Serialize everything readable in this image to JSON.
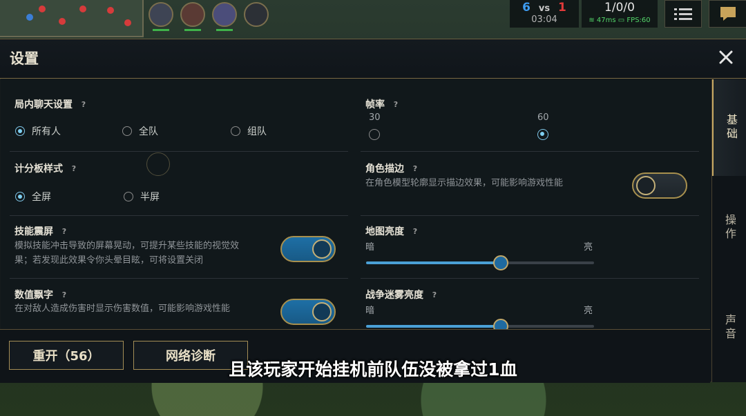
{
  "hud": {
    "score_blue": "6",
    "score_vs": "vs",
    "score_red": "1",
    "timer": "03:04",
    "kda": "1/0/0",
    "ping": "47ms",
    "fps": "FPS:60"
  },
  "panel": {
    "title": "设置",
    "tabs": [
      {
        "label": "基础",
        "active": true
      },
      {
        "label": "操作",
        "active": false
      },
      {
        "label": "声音",
        "active": false
      }
    ]
  },
  "settings": {
    "chat": {
      "title": "局内聊天设置",
      "help": "?",
      "options": [
        "所有人",
        "全队",
        "组队"
      ],
      "selected": "所有人"
    },
    "framerate": {
      "title": "帧率",
      "help": "?",
      "options": [
        "30",
        "60"
      ],
      "selected": "60"
    },
    "scoreboard": {
      "title": "计分板样式",
      "help": "?",
      "options": [
        "全屏",
        "半屏"
      ],
      "selected": "全屏"
    },
    "outline": {
      "title": "角色描边",
      "help": "?",
      "desc": "在角色模型轮廓显示描边效果，可能影响游戏性能",
      "enabled": false
    },
    "shake": {
      "title": "技能震屏",
      "help": "?",
      "desc_line1": "模拟技能冲击导致的屏幕晃动，可提升某些技能的视觉效",
      "desc_line2": "果；若发现此效果令你头晕目眩，可将设置关闭",
      "enabled": true
    },
    "map_brightness": {
      "title": "地图亮度",
      "help": "?",
      "min_label": "暗",
      "max_label": "亮",
      "level": 0.59
    },
    "damage_numbers": {
      "title": "数值飘字",
      "help": "?",
      "desc": "在对敌人造成伤害时显示伤害数值，可能影响游戏性能",
      "enabled": true
    },
    "fog_brightness": {
      "title": "战争迷雾亮度",
      "help": "?",
      "min_label": "暗",
      "max_label": "亮",
      "level": 0.59
    }
  },
  "buttons": {
    "restart": "重开（56）",
    "network": "网络诊断"
  },
  "subtitle": "且该玩家开始挂机前队伍没被拿过1血",
  "colors": {
    "accent_gold": "#a8904e",
    "toggle_on": "#1e6fa5",
    "radio_selected": "#7fd0f2",
    "team_blue": "#3d9bf0",
    "team_red": "#e23a3a"
  }
}
